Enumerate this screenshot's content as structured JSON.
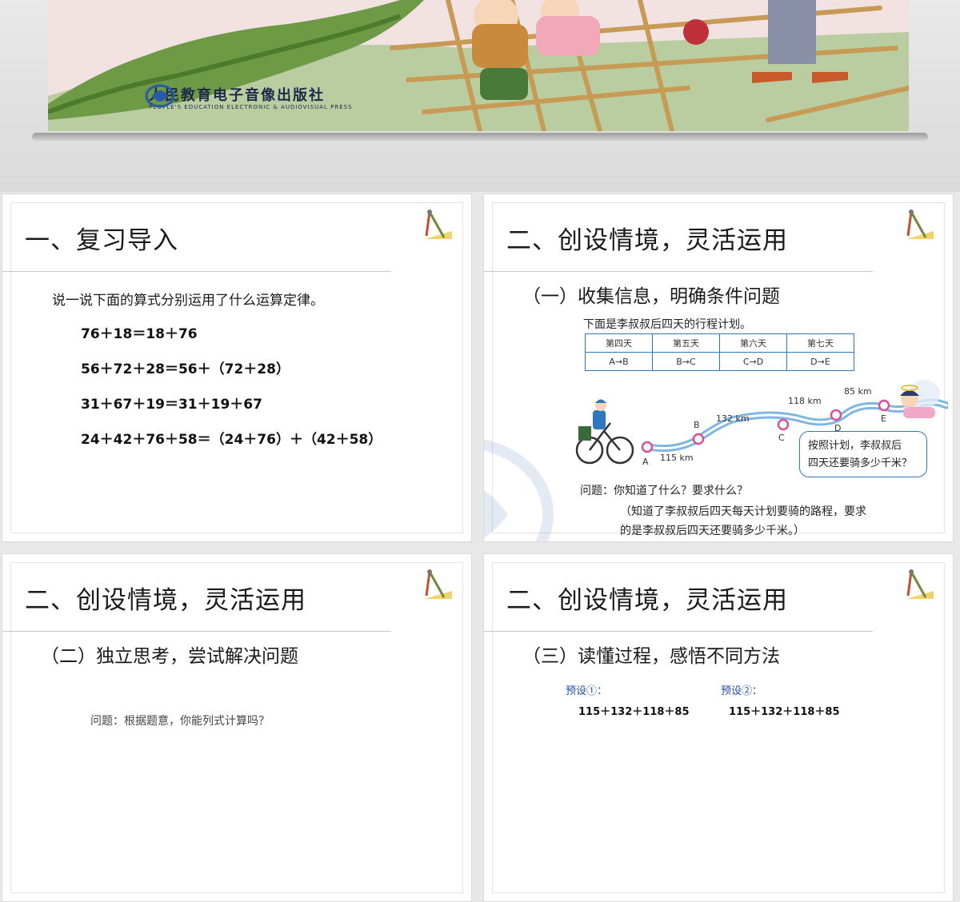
{
  "cover": {
    "publisher_cn": "人民教育电子音像出版社",
    "publisher_en": "PEOPLE'S EDUCATION ELECTRONIC & AUDIOVISUAL PRESS"
  },
  "slide1": {
    "title": "一、复习导入",
    "prompt": "说一说下面的算式分别运用了什么运算定律。",
    "equations": [
      "76＋18＝18＋76",
      "56＋72＋28＝56＋（72＋28）",
      "31＋67＋19＝31＋19＋67",
      "24＋42＋76＋58＝（24＋76）＋（42＋58）"
    ]
  },
  "slide2": {
    "title": "二、创设情境，灵活运用",
    "subhead": "（一）收集信息，明确条件问题",
    "intro": "下面是李叔叔后四天的行程计划。",
    "table": {
      "headers": [
        "第四天",
        "第五天",
        "第六天",
        "第七天"
      ],
      "routes": [
        "A→B",
        "B→C",
        "C→D",
        "D→E"
      ]
    },
    "route": {
      "points": [
        "A",
        "B",
        "C",
        "D",
        "E"
      ],
      "distances": [
        "115 km",
        "132 km",
        "118 km",
        "85 km"
      ]
    },
    "speech": [
      "按照计划，李叔叔后",
      "四天还要骑多少千米？"
    ],
    "question": "问题：你知道了什么？要求什么？",
    "answer_line1": "（知道了李叔叔后四天每天计划要骑的路程，要求",
    "answer_line2": "的是李叔叔后四天还要骑多少千米。）"
  },
  "slide3": {
    "title": "二、创设情境，灵活运用",
    "subhead": "（二）独立思考，尝试解决问题",
    "partial": "问题：根据题意，你能列式计算吗？"
  },
  "slide4": {
    "title": "二、创设情境，灵活运用",
    "subhead": "（三）读懂过程，感悟不同方法",
    "presets": [
      {
        "label": "预设①：",
        "expr": "115＋132＋118＋85"
      },
      {
        "label": "预设②：",
        "expr": "115＋132＋118＋85"
      }
    ]
  },
  "colors": {
    "accent_blue": "#2f78c0",
    "preset_blue": "#1f4aa8",
    "marker_pink": "#d9509a",
    "cover_bg": "#f0dede"
  },
  "icons": [
    "publisher-logo-icon",
    "ruler-compass-icon",
    "cyclist-icon",
    "angel-girl-icon",
    "watermark-logo-icon"
  ]
}
